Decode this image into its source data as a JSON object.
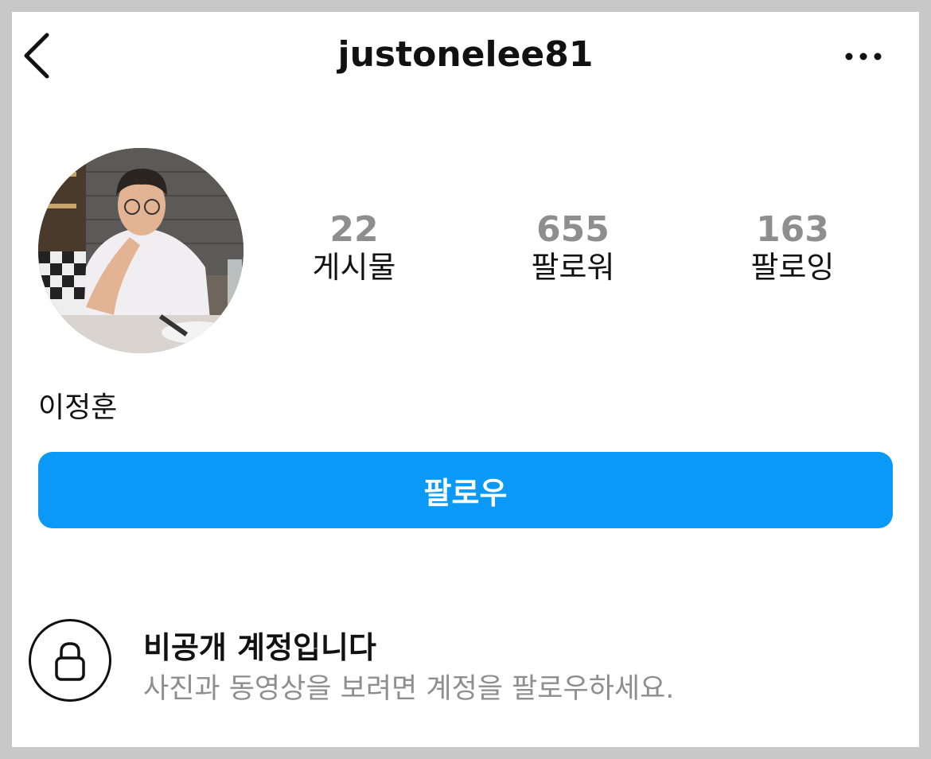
{
  "header": {
    "username": "justonelee81",
    "back_icon": "chevron-left-icon",
    "more_icon": "more-horizontal-icon"
  },
  "profile": {
    "avatar": "profile-photo",
    "full_name": "이정훈",
    "stats": {
      "posts": {
        "count": "22",
        "label": "게시물"
      },
      "followers": {
        "count": "655",
        "label": "팔로워"
      },
      "following": {
        "count": "163",
        "label": "팔로잉"
      }
    }
  },
  "actions": {
    "follow_label": "팔로우"
  },
  "private_notice": {
    "icon": "lock-icon",
    "title": "비공개 계정입니다",
    "description": "사진과 동영상을 보려면 계정을 팔로우하세요."
  },
  "colors": {
    "accent": "#0a99f6",
    "muted_text": "#8e8e8e",
    "text": "#111111",
    "background": "#ffffff"
  }
}
